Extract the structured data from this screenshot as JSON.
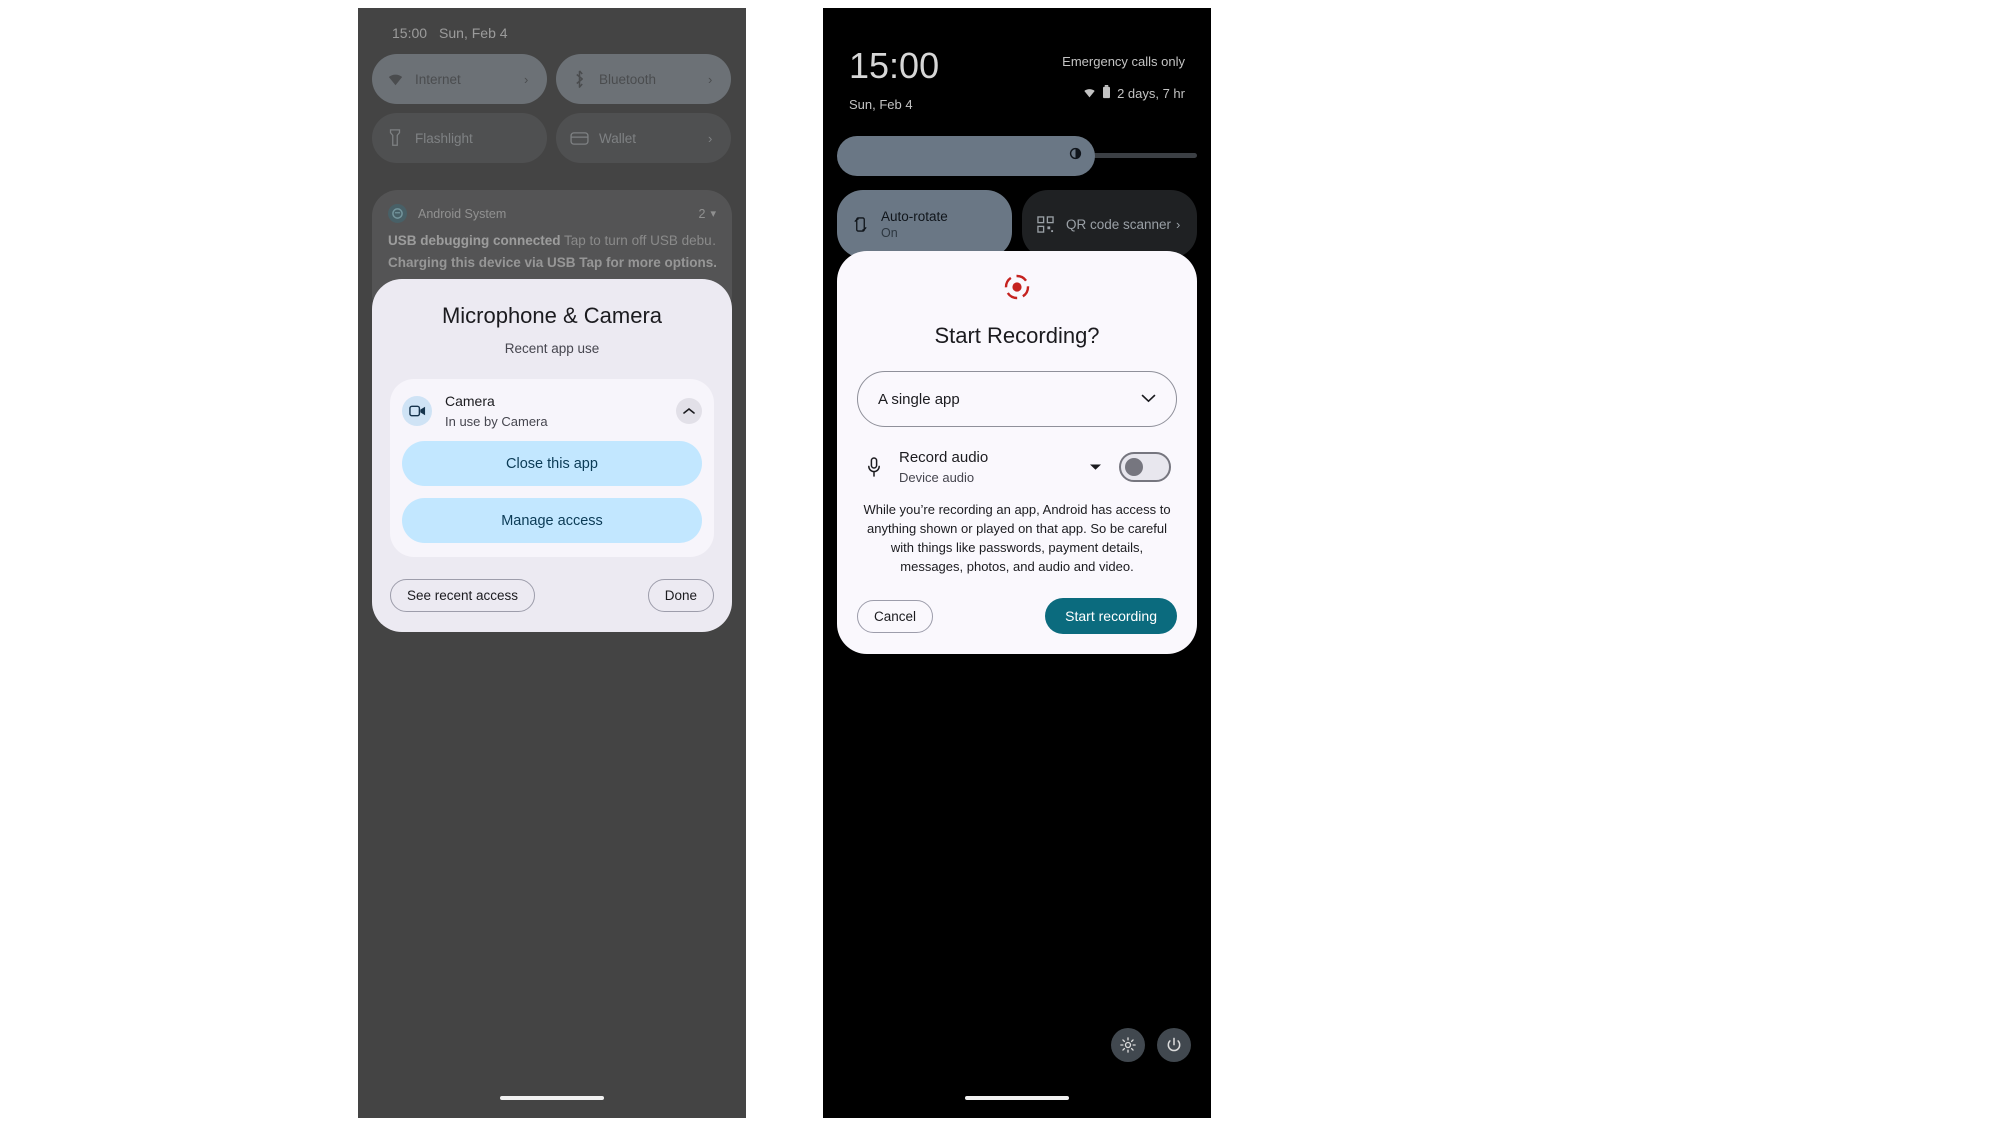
{
  "left_phone": {
    "status_bar": {
      "clock": "15:00",
      "date": "Sun, Feb 4"
    },
    "quick_settings": {
      "tiles": [
        {
          "label": "Internet",
          "icon": "wifi-icon",
          "state": "on",
          "chevron": "›"
        },
        {
          "label": "Bluetooth",
          "icon": "bluetooth-icon",
          "state": "on",
          "chevron": "›"
        },
        {
          "label": "Flashlight",
          "icon": "flashlight-icon",
          "state": "off",
          "chevron": ""
        },
        {
          "label": "Wallet",
          "icon": "wallet-icon",
          "state": "off",
          "chevron": "›"
        }
      ]
    },
    "notification": {
      "app_name": "Android System",
      "count": "2",
      "expand_icon": "chevron-down-icon",
      "title": "USB debugging connected",
      "title_detail": "Tap to turn off USB debu…",
      "subtitle": "Charging this device via USB Tap for more options."
    },
    "permission_dialog": {
      "title": "Microphone & Camera",
      "subtitle": "Recent app use",
      "entry": {
        "name": "Camera",
        "status": "In use by Camera",
        "icon": "camera-icon",
        "collapse_icon": "chevron-up-icon"
      },
      "actions": [
        {
          "label": "Close this app"
        },
        {
          "label": "Manage access"
        }
      ],
      "footer": {
        "see_recent_access": "See recent access",
        "done": "Done"
      }
    }
  },
  "right_phone": {
    "status_bar": {
      "clock": "15:00",
      "date": "Sun, Feb 4",
      "carrier": "Emergency calls only",
      "battery": "2 days, 7 hr",
      "wifi_icon": "wifi-icon",
      "battery_icon": "battery-icon"
    },
    "brightness": {
      "icon": "brightness-icon",
      "level_percent": 72
    },
    "quick_settings": {
      "tiles": [
        {
          "label": "Auto-rotate",
          "state_text": "On",
          "icon": "auto-rotate-icon",
          "state": "on",
          "chevron": ""
        },
        {
          "label": "QR code scanner",
          "state_text": "",
          "icon": "qr-code-icon",
          "state": "off",
          "chevron": "›"
        }
      ]
    },
    "record_dialog": {
      "icon": "screen-record-icon",
      "title": "Start Recording?",
      "scope_select": {
        "value": "A single app",
        "caret_icon": "chevron-down-icon"
      },
      "record_audio": {
        "label": "Record audio",
        "sub_label": "Device audio",
        "icon": "microphone-icon",
        "caret_icon": "caret-down-icon",
        "toggle_state": "off"
      },
      "body_text": "While you’re recording an app, Android has access to anything shown or played on that app. So be careful with things like passwords, payment details, messages, photos, and audio and video.",
      "footer": {
        "cancel": "Cancel",
        "start": "Start recording"
      }
    },
    "footer_buttons": [
      {
        "icon": "gear-icon"
      },
      {
        "icon": "power-icon"
      }
    ]
  },
  "colors": {
    "tile_on": "#6a7785",
    "tile_off": "#1f2123",
    "dialog_bg_left": "#eceaf2",
    "dialog_bg_right": "#faf8fd",
    "action_blue": "#c2e7ff",
    "accent_teal": "#0b6b7e",
    "record_red": "#c5221f"
  }
}
